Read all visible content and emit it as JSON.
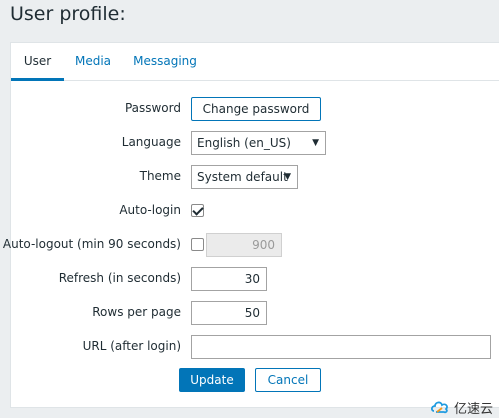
{
  "page": {
    "title": "User profile:"
  },
  "tabs": [
    {
      "label": "User",
      "active": true
    },
    {
      "label": "Media",
      "active": false
    },
    {
      "label": "Messaging",
      "active": false
    }
  ],
  "form": {
    "password": {
      "label": "Password",
      "button": "Change password"
    },
    "language": {
      "label": "Language",
      "value": "English (en_US)"
    },
    "theme": {
      "label": "Theme",
      "value": "System default"
    },
    "autologin": {
      "label": "Auto-login",
      "checked": true
    },
    "autologout": {
      "label": "Auto-logout (min 90 seconds)",
      "checked": false,
      "value": "900"
    },
    "refresh": {
      "label": "Refresh (in seconds)",
      "value": "30"
    },
    "rows_per_page": {
      "label": "Rows per page",
      "value": "50"
    },
    "url": {
      "label": "URL (after login)",
      "value": ""
    }
  },
  "actions": {
    "update": "Update",
    "cancel": "Cancel"
  },
  "watermark": {
    "text": "亿速云"
  },
  "colors": {
    "accent": "#0275b8",
    "page_bg": "#ebeef0",
    "panel_bg": "#ffffff"
  }
}
